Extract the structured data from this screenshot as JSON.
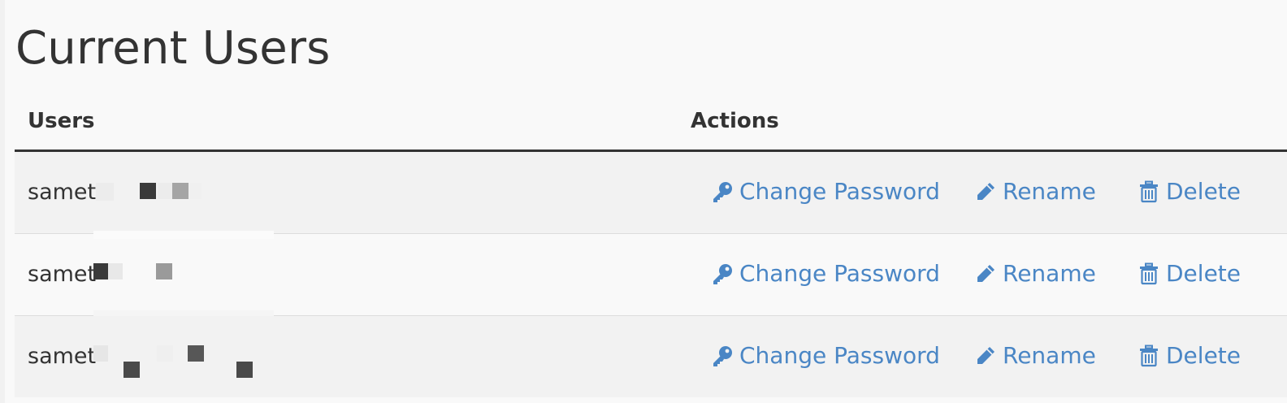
{
  "page": {
    "title": "Current Users"
  },
  "table": {
    "headers": {
      "users": "Users",
      "actions": "Actions"
    },
    "rows": [
      {
        "username": "samet"
      },
      {
        "username": "samet"
      },
      {
        "username": "samet"
      }
    ],
    "actions": {
      "change_password": "Change Password",
      "rename": "Rename",
      "delete": "Delete"
    }
  },
  "colors": {
    "link": "#4a86c5",
    "text": "#333333",
    "row_alt": "#f2f2f2",
    "background": "#f9f9f9"
  },
  "icons": {
    "change_password": "key-icon",
    "rename": "pencil-icon",
    "delete": "trash-icon"
  }
}
